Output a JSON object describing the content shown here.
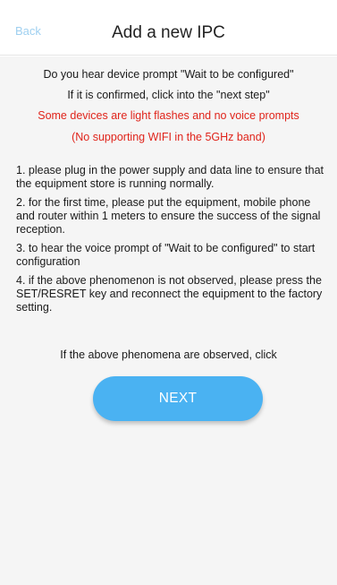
{
  "header": {
    "back_label": "Back",
    "title": "Add a new IPC"
  },
  "prompts": {
    "line1": "Do you hear device prompt \"Wait to be configured\"",
    "line2": "If it is confirmed, click into the \"next step\"",
    "warning1": "Some devices are light flashes and no voice prompts",
    "warning2": "(No supporting WIFI in the 5GHz band)"
  },
  "steps": [
    "1. please plug in the power supply and data line to ensure that the equipment store is running normally.",
    "2. for the first time, please put the equipment, mobile phone and router within 1 meters to ensure the success of the signal reception.",
    "3. to hear the voice prompt of \"Wait to be configured\" to start configuration",
    "4. if the above phenomenon is not observed, please press the SET/RESRET key and reconnect the equipment to the factory setting."
  ],
  "footer": {
    "observed_text": "If the above phenomena are observed, click",
    "next_label": "NEXT"
  },
  "colors": {
    "back": "#9fd0f0",
    "warning": "#e0241b",
    "button": "#4ab2f2",
    "background": "#f5f5f5"
  }
}
